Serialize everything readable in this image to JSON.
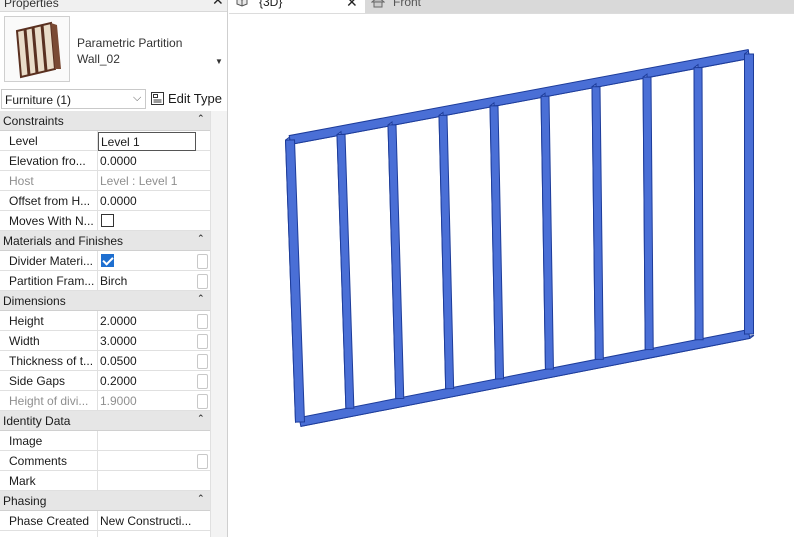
{
  "properties_panel": {
    "title": "Properties",
    "type_selector": {
      "name": "Parametric Partition Wall_02"
    },
    "filter": {
      "selected": "Furniture (1)",
      "edit_type_label": "Edit Type"
    },
    "groups": [
      {
        "label": "Constraints",
        "rows": [
          {
            "name": "Level",
            "value": "Level 1"
          },
          {
            "name": "Elevation fro...",
            "value": "0.0000"
          },
          {
            "name": "Host",
            "value": "Level : Level 1"
          },
          {
            "name": "Offset from H...",
            "value": "0.0000"
          },
          {
            "name": "Moves With N...",
            "value": ""
          }
        ]
      },
      {
        "label": "Materials and Finishes",
        "rows": [
          {
            "name": "Divider Materi...",
            "value": ""
          },
          {
            "name": "Partition Fram...",
            "value": "Birch"
          }
        ]
      },
      {
        "label": "Dimensions",
        "rows": [
          {
            "name": "Height",
            "value": "2.0000"
          },
          {
            "name": "Width",
            "value": "3.0000"
          },
          {
            "name": "Thickness of t...",
            "value": "0.0500"
          },
          {
            "name": "Side Gaps",
            "value": "0.2000"
          },
          {
            "name": "Height of divi...",
            "value": "1.9000"
          }
        ]
      },
      {
        "label": "Identity Data",
        "rows": [
          {
            "name": "Image",
            "value": ""
          },
          {
            "name": "Comments",
            "value": ""
          },
          {
            "name": "Mark",
            "value": ""
          }
        ]
      },
      {
        "label": "Phasing",
        "rows": [
          {
            "name": "Phase Created",
            "value": "New Constructi..."
          }
        ]
      }
    ]
  },
  "tabs": [
    {
      "label": "{3D}",
      "active": true
    },
    {
      "label": "Front",
      "active": false
    }
  ],
  "colors": {
    "wall_front": "#4a6fd6",
    "wall_side": "#6f8fe6",
    "wall_edge": "#1d3c9a"
  }
}
